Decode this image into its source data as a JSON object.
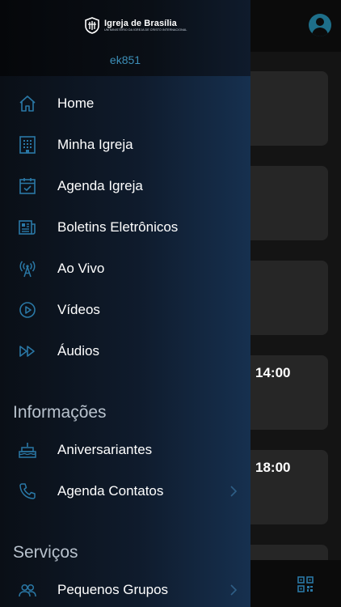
{
  "brand": {
    "title": "Igreja de Brasília",
    "subtitle": "UM MINISTÉRIO DA IGREJA DE CRISTO INTERNACIONAL"
  },
  "user": {
    "username": "ek851"
  },
  "menu": {
    "main": [
      {
        "label": "Home",
        "icon": "home-icon"
      },
      {
        "label": "Minha Igreja",
        "icon": "building-icon"
      },
      {
        "label": "Agenda Igreja",
        "icon": "calendar-check-icon"
      },
      {
        "label": "Boletins Eletrônicos",
        "icon": "newspaper-icon"
      },
      {
        "label": "Ao Vivo",
        "icon": "broadcast-antenna-icon"
      },
      {
        "label": "Vídeos",
        "icon": "play-circle-icon"
      },
      {
        "label": "Áudios",
        "icon": "fast-forward-icon"
      }
    ],
    "info_title": "Informações",
    "info": [
      {
        "label": "Aniversariantes",
        "icon": "birthday-cake-icon"
      },
      {
        "label": "Agenda Contatos",
        "icon": "phone-icon"
      }
    ],
    "services_title": "Serviços",
    "services": [
      {
        "label": "Pequenos Grupos",
        "icon": "people-group-icon"
      }
    ]
  },
  "background": {
    "times": [
      "14:00",
      "18:00"
    ]
  },
  "colors": {
    "accent": "#2f8fbf",
    "icon": "#2a78a6",
    "drawer_dark": "#0a0f16",
    "drawer_light": "#16304f"
  }
}
